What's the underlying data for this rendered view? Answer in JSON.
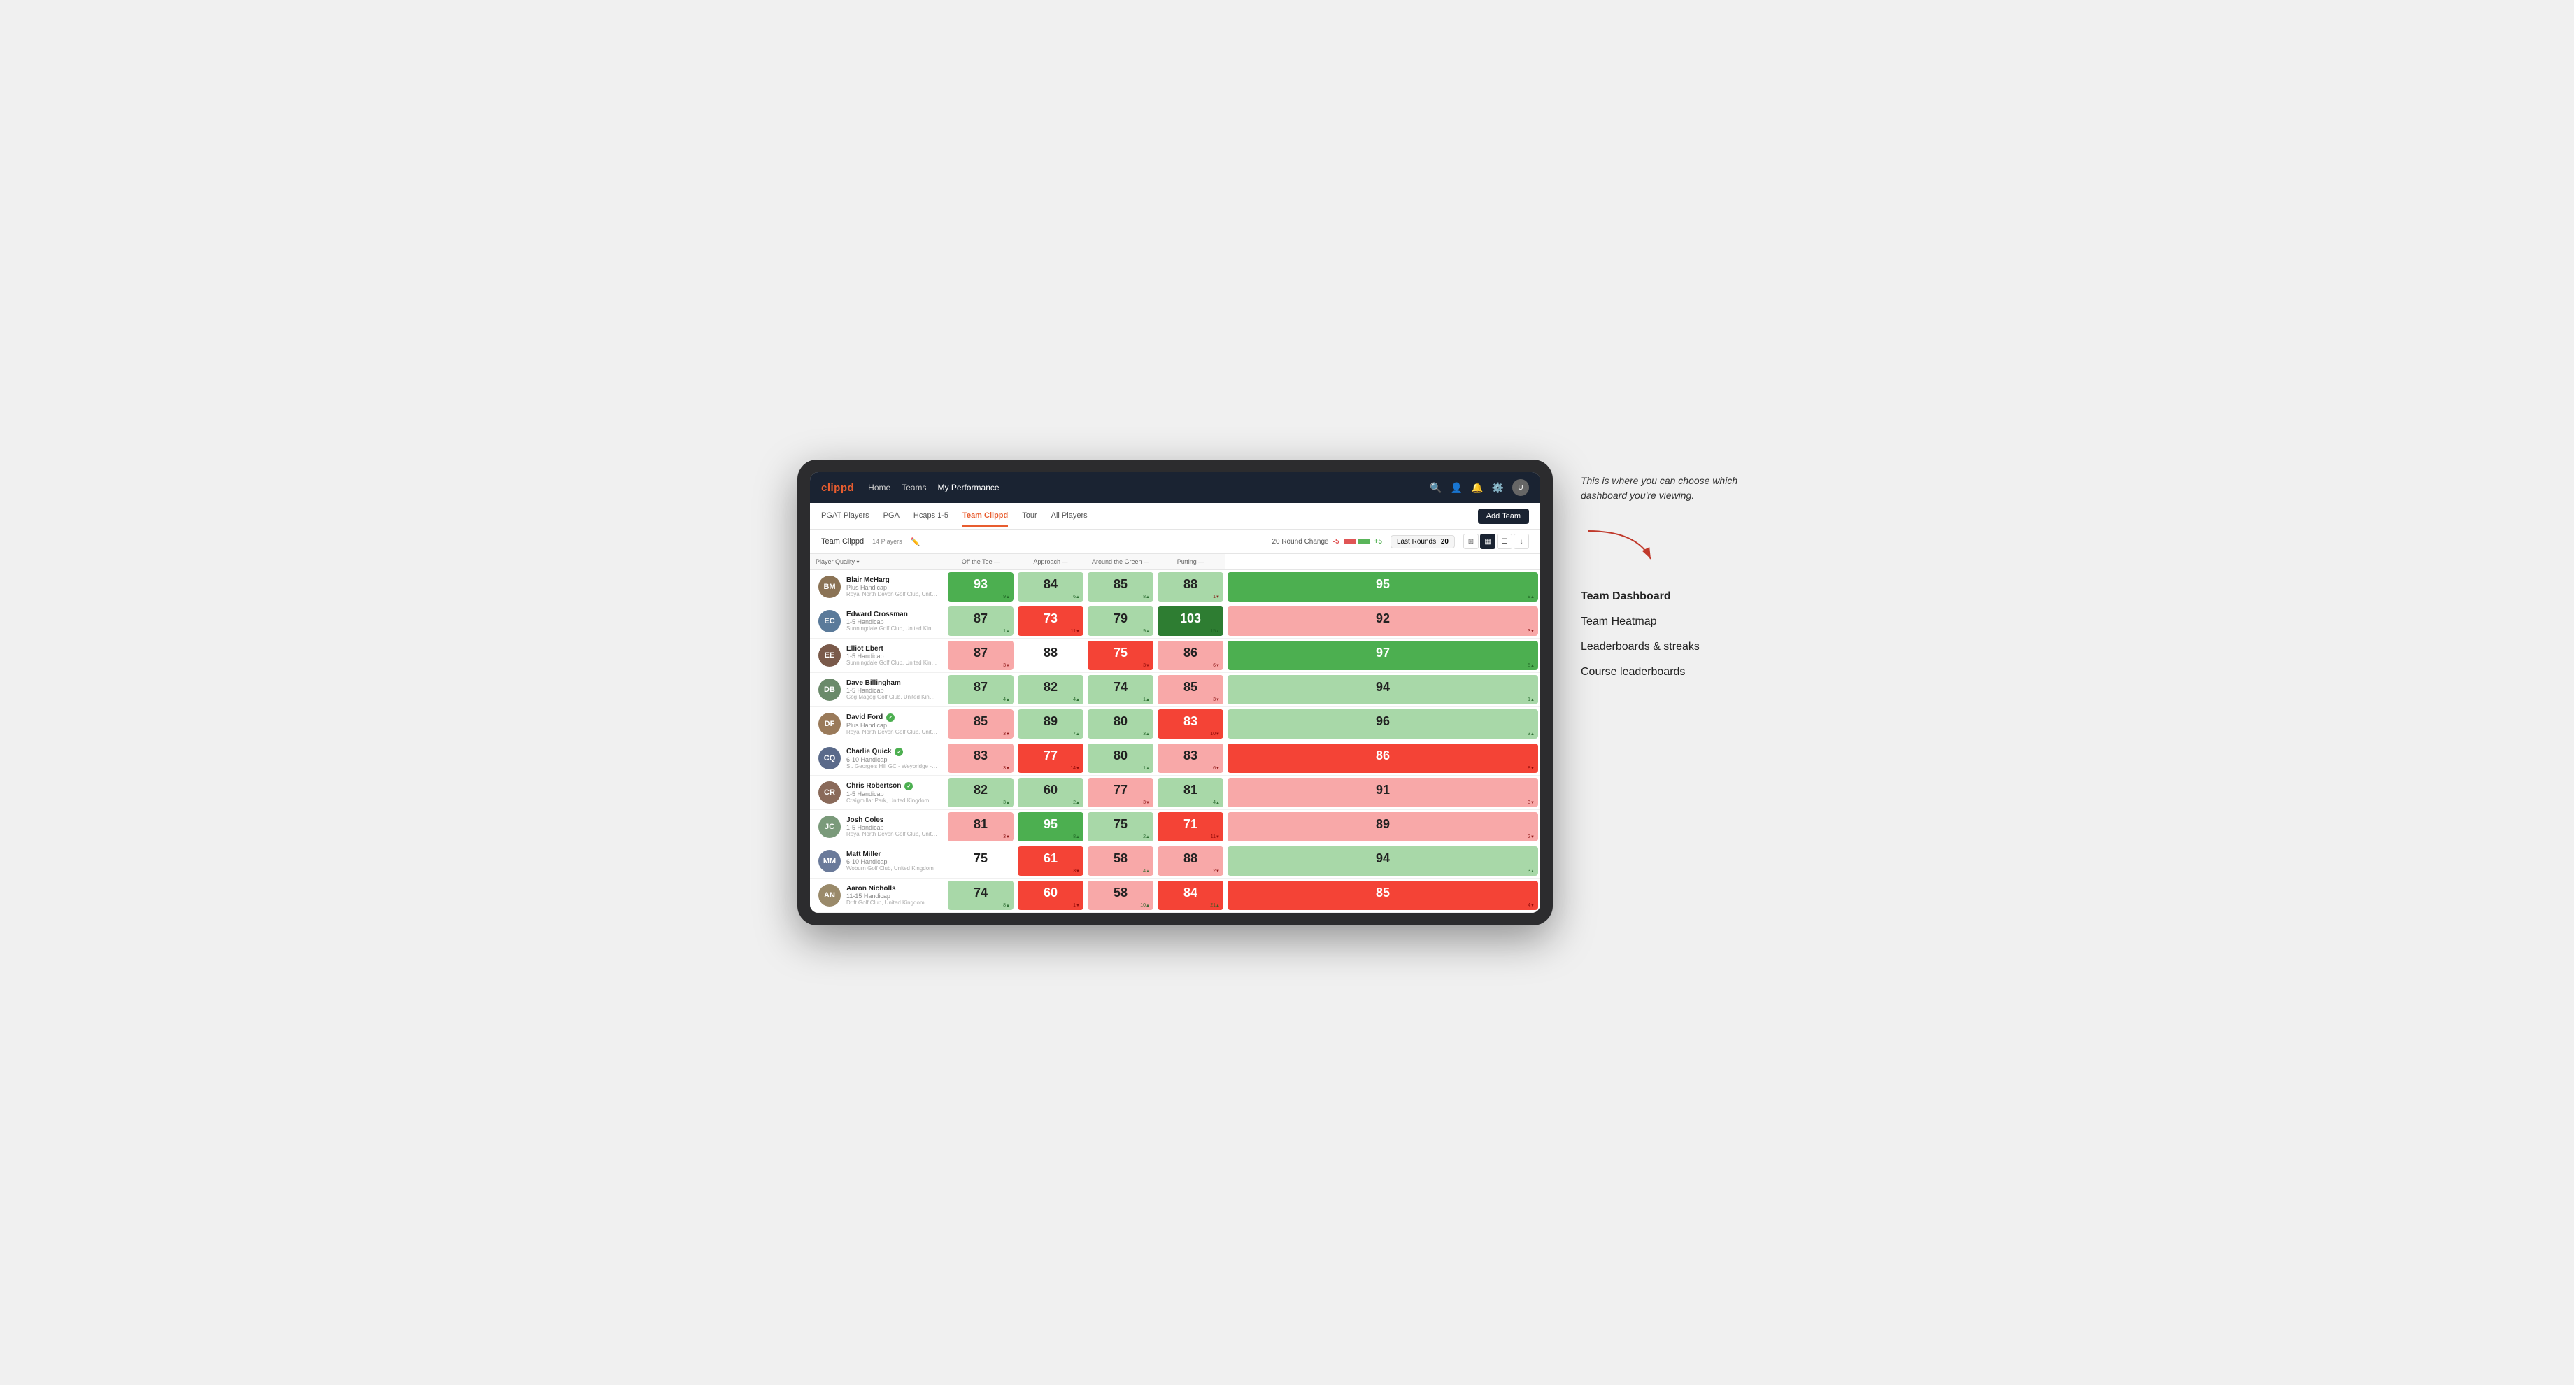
{
  "annotation": {
    "tooltip_text": "This is where you can choose which dashboard you're viewing.",
    "menu_items": [
      {
        "label": "Team Dashboard",
        "active": true
      },
      {
        "label": "Team Heatmap",
        "active": false
      },
      {
        "label": "Leaderboards & streaks",
        "active": false
      },
      {
        "label": "Course leaderboards",
        "active": false
      }
    ]
  },
  "nav": {
    "logo": "clippd",
    "links": [
      {
        "label": "Home",
        "active": false
      },
      {
        "label": "Teams",
        "active": false
      },
      {
        "label": "My Performance",
        "active": true
      }
    ],
    "add_team_label": "Add Team"
  },
  "sub_nav": {
    "tabs": [
      {
        "label": "PGAT Players",
        "active": false
      },
      {
        "label": "PGA",
        "active": false
      },
      {
        "label": "Hcaps 1-5",
        "active": false
      },
      {
        "label": "Team Clippd",
        "active": true
      },
      {
        "label": "Tour",
        "active": false
      },
      {
        "label": "All Players",
        "active": false
      }
    ]
  },
  "toolbar": {
    "team_title": "Team Clippd",
    "player_count": "14 Players",
    "round_change_label": "20 Round Change",
    "minus_val": "-5",
    "plus_val": "+5",
    "last_rounds_label": "Last Rounds:",
    "last_rounds_val": "20"
  },
  "table": {
    "col_headers": [
      {
        "label": "Player Quality",
        "sortable": true
      },
      {
        "label": "Off the Tee",
        "sortable": true
      },
      {
        "label": "Approach",
        "sortable": true
      },
      {
        "label": "Around the Green",
        "sortable": true
      },
      {
        "label": "Putting",
        "sortable": true
      }
    ],
    "players": [
      {
        "name": "Blair McHarg",
        "handicap": "Plus Handicap",
        "club": "Royal North Devon Golf Club, United Kingdom",
        "avatar_color": "#8B7355",
        "initials": "BM",
        "scores": [
          {
            "value": "93",
            "delta": "9",
            "dir": "up",
            "bg": "score-green"
          },
          {
            "value": "84",
            "delta": "6",
            "dir": "up",
            "bg": "score-light-green"
          },
          {
            "value": "85",
            "delta": "8",
            "dir": "up",
            "bg": "score-light-green"
          },
          {
            "value": "88",
            "delta": "1",
            "dir": "down",
            "bg": "score-light-green"
          },
          {
            "value": "95",
            "delta": "9",
            "dir": "up",
            "bg": "score-green"
          }
        ]
      },
      {
        "name": "Edward Crossman",
        "handicap": "1-5 Handicap",
        "club": "Sunningdale Golf Club, United Kingdom",
        "avatar_color": "#5a7a9a",
        "initials": "EC",
        "scores": [
          {
            "value": "87",
            "delta": "1",
            "dir": "up",
            "bg": "score-light-green"
          },
          {
            "value": "73",
            "delta": "11",
            "dir": "down",
            "bg": "score-red"
          },
          {
            "value": "79",
            "delta": "9",
            "dir": "up",
            "bg": "score-light-green"
          },
          {
            "value": "103",
            "delta": "15",
            "dir": "up",
            "bg": "score-dark-green"
          },
          {
            "value": "92",
            "delta": "3",
            "dir": "down",
            "bg": "score-light-red"
          }
        ]
      },
      {
        "name": "Elliot Ebert",
        "handicap": "1-5 Handicap",
        "club": "Sunningdale Golf Club, United Kingdom",
        "avatar_color": "#7a5a4a",
        "initials": "EE",
        "scores": [
          {
            "value": "87",
            "delta": "3",
            "dir": "down",
            "bg": "score-light-red"
          },
          {
            "value": "88",
            "delta": "",
            "dir": "none",
            "bg": "score-white"
          },
          {
            "value": "75",
            "delta": "3",
            "dir": "down",
            "bg": "score-red"
          },
          {
            "value": "86",
            "delta": "6",
            "dir": "down",
            "bg": "score-light-red"
          },
          {
            "value": "97",
            "delta": "5",
            "dir": "up",
            "bg": "score-green"
          }
        ]
      },
      {
        "name": "Dave Billingham",
        "handicap": "1-5 Handicap",
        "club": "Gog Magog Golf Club, United Kingdom",
        "avatar_color": "#6a8a6a",
        "initials": "DB",
        "scores": [
          {
            "value": "87",
            "delta": "4",
            "dir": "up",
            "bg": "score-light-green"
          },
          {
            "value": "82",
            "delta": "4",
            "dir": "up",
            "bg": "score-light-green"
          },
          {
            "value": "74",
            "delta": "1",
            "dir": "up",
            "bg": "score-light-green"
          },
          {
            "value": "85",
            "delta": "3",
            "dir": "down",
            "bg": "score-light-red"
          },
          {
            "value": "94",
            "delta": "1",
            "dir": "up",
            "bg": "score-light-green"
          }
        ]
      },
      {
        "name": "David Ford",
        "handicap": "Plus Handicap",
        "club": "Royal North Devon Golf Club, United Kingdom",
        "avatar_color": "#9a7a5a",
        "initials": "DF",
        "verified": true,
        "scores": [
          {
            "value": "85",
            "delta": "3",
            "dir": "down",
            "bg": "score-light-red"
          },
          {
            "value": "89",
            "delta": "7",
            "dir": "up",
            "bg": "score-light-green"
          },
          {
            "value": "80",
            "delta": "3",
            "dir": "up",
            "bg": "score-light-green"
          },
          {
            "value": "83",
            "delta": "10",
            "dir": "down",
            "bg": "score-red"
          },
          {
            "value": "96",
            "delta": "3",
            "dir": "up",
            "bg": "score-light-green"
          }
        ]
      },
      {
        "name": "Charlie Quick",
        "handicap": "6-10 Handicap",
        "club": "St. George's Hill GC - Weybridge - Surrey, United Kingdom",
        "avatar_color": "#5a6a8a",
        "initials": "CQ",
        "verified": true,
        "scores": [
          {
            "value": "83",
            "delta": "3",
            "dir": "down",
            "bg": "score-light-red"
          },
          {
            "value": "77",
            "delta": "14",
            "dir": "down",
            "bg": "score-red"
          },
          {
            "value": "80",
            "delta": "1",
            "dir": "up",
            "bg": "score-light-green"
          },
          {
            "value": "83",
            "delta": "6",
            "dir": "down",
            "bg": "score-light-red"
          },
          {
            "value": "86",
            "delta": "8",
            "dir": "down",
            "bg": "score-red"
          }
        ]
      },
      {
        "name": "Chris Robertson",
        "handicap": "1-5 Handicap",
        "club": "Craigmillar Park, United Kingdom",
        "avatar_color": "#8a6a5a",
        "initials": "CR",
        "verified": true,
        "scores": [
          {
            "value": "82",
            "delta": "3",
            "dir": "up",
            "bg": "score-light-green"
          },
          {
            "value": "60",
            "delta": "2",
            "dir": "up",
            "bg": "score-light-green"
          },
          {
            "value": "77",
            "delta": "3",
            "dir": "down",
            "bg": "score-light-red"
          },
          {
            "value": "81",
            "delta": "4",
            "dir": "up",
            "bg": "score-light-green"
          },
          {
            "value": "91",
            "delta": "3",
            "dir": "down",
            "bg": "score-light-red"
          }
        ]
      },
      {
        "name": "Josh Coles",
        "handicap": "1-5 Handicap",
        "club": "Royal North Devon Golf Club, United Kingdom",
        "avatar_color": "#7a9a7a",
        "initials": "JC",
        "scores": [
          {
            "value": "81",
            "delta": "3",
            "dir": "down",
            "bg": "score-light-red"
          },
          {
            "value": "95",
            "delta": "8",
            "dir": "up",
            "bg": "score-green"
          },
          {
            "value": "75",
            "delta": "2",
            "dir": "up",
            "bg": "score-light-green"
          },
          {
            "value": "71",
            "delta": "11",
            "dir": "down",
            "bg": "score-red"
          },
          {
            "value": "89",
            "delta": "2",
            "dir": "down",
            "bg": "score-light-red"
          }
        ]
      },
      {
        "name": "Matt Miller",
        "handicap": "6-10 Handicap",
        "club": "Woburn Golf Club, United Kingdom",
        "avatar_color": "#6a7a9a",
        "initials": "MM",
        "scores": [
          {
            "value": "75",
            "delta": "",
            "dir": "none",
            "bg": "score-white"
          },
          {
            "value": "61",
            "delta": "3",
            "dir": "down",
            "bg": "score-red"
          },
          {
            "value": "58",
            "delta": "4",
            "dir": "up",
            "bg": "score-light-red"
          },
          {
            "value": "88",
            "delta": "2",
            "dir": "down",
            "bg": "score-light-red"
          },
          {
            "value": "94",
            "delta": "3",
            "dir": "up",
            "bg": "score-light-green"
          }
        ]
      },
      {
        "name": "Aaron Nicholls",
        "handicap": "11-15 Handicap",
        "club": "Drift Golf Club, United Kingdom",
        "avatar_color": "#9a8a6a",
        "initials": "AN",
        "scores": [
          {
            "value": "74",
            "delta": "8",
            "dir": "up",
            "bg": "score-light-green"
          },
          {
            "value": "60",
            "delta": "1",
            "dir": "down",
            "bg": "score-red"
          },
          {
            "value": "58",
            "delta": "10",
            "dir": "up",
            "bg": "score-light-red"
          },
          {
            "value": "84",
            "delta": "21",
            "dir": "up",
            "bg": "score-red"
          },
          {
            "value": "85",
            "delta": "4",
            "dir": "down",
            "bg": "score-red"
          }
        ]
      }
    ]
  }
}
